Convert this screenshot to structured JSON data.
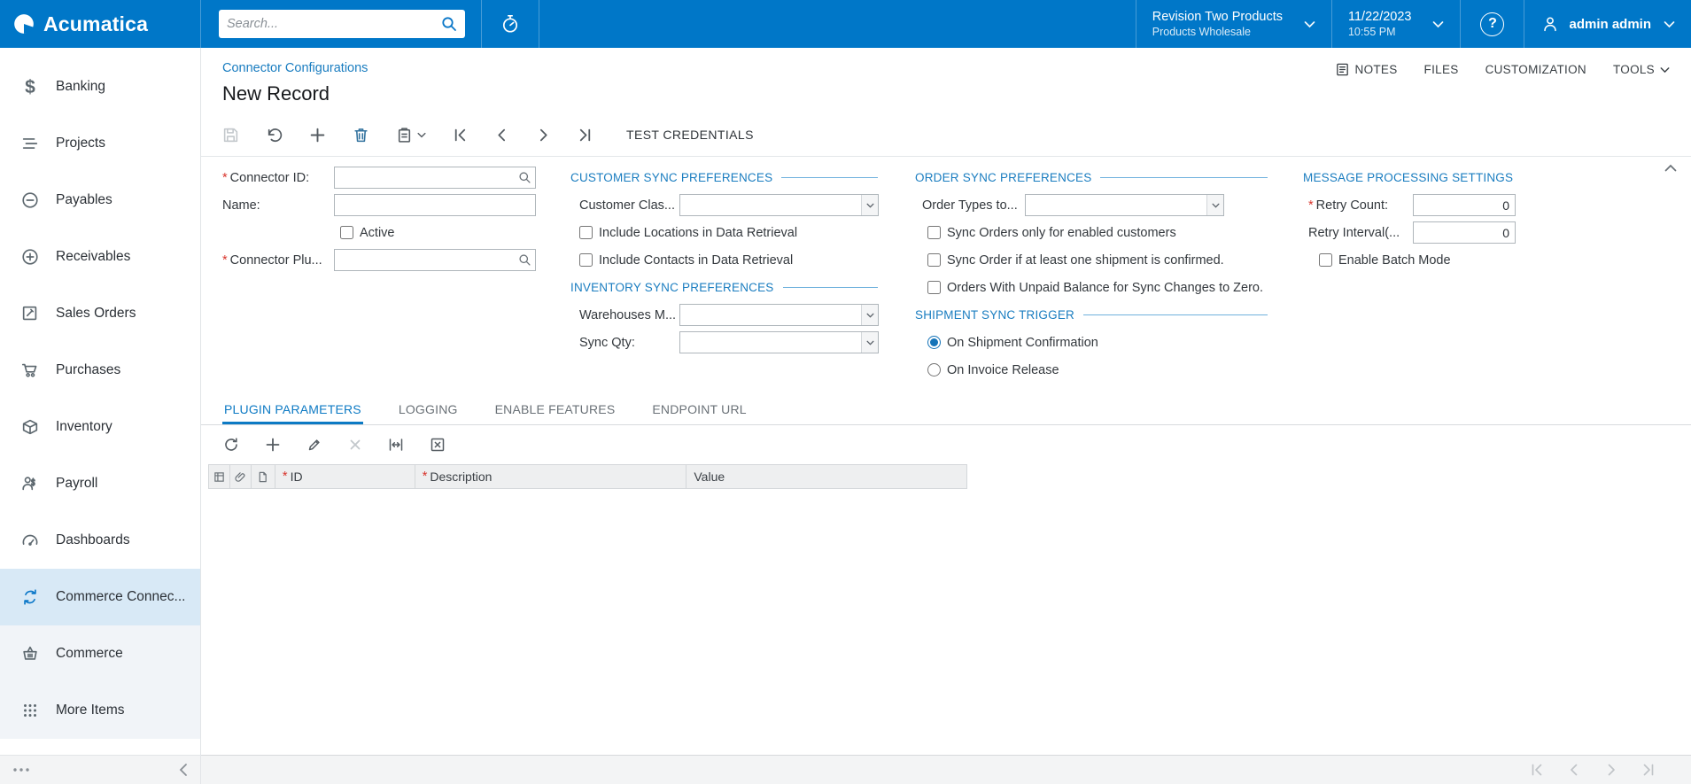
{
  "ui": {
    "required_marker": "*",
    "help_glyph": "?",
    "dollar_glyph": "$"
  },
  "colors": {
    "brand_blue": "#0077c8",
    "link_blue": "#1a7dc0",
    "required_red": "#d8342c",
    "selected_nav_bg": "#d8e9f6",
    "tab_active_blue": "#0d7ac4"
  },
  "topbar": {
    "brand": "Acumatica",
    "search_placeholder": "Search...",
    "company_name": "Revision Two Products",
    "company_branch": "Products Wholesale",
    "date": "11/22/2023",
    "time": "10:55 PM",
    "user": "admin admin"
  },
  "sidebar": {
    "items": [
      {
        "label": "Banking"
      },
      {
        "label": "Projects"
      },
      {
        "label": "Payables"
      },
      {
        "label": "Receivables"
      },
      {
        "label": "Sales Orders"
      },
      {
        "label": "Purchases"
      },
      {
        "label": "Inventory"
      },
      {
        "label": "Payroll"
      },
      {
        "label": "Dashboards"
      },
      {
        "label": "Commerce Connec..."
      },
      {
        "label": "Commerce"
      },
      {
        "label": "More Items"
      }
    ]
  },
  "header": {
    "breadcrumb": "Connector Configurations",
    "title": "New Record",
    "actions": {
      "notes": "NOTES",
      "files": "FILES",
      "customization": "CUSTOMIZATION",
      "tools": "TOOLS"
    },
    "test_credentials": "TEST CREDENTIALS"
  },
  "form": {
    "connector_id_label": "Connector ID:",
    "name_label": "Name:",
    "active_label": "Active",
    "connector_plugin_label": "Connector Plu...",
    "customer_sync": {
      "title": "CUSTOMER SYNC PREFERENCES",
      "customer_class_label": "Customer Clas...",
      "include_locations_label": "Include Locations in Data Retrieval",
      "include_contacts_label": "Include Contacts in Data Retrieval"
    },
    "inventory_sync": {
      "title": "INVENTORY SYNC PREFERENCES",
      "warehouses_label": "Warehouses M...",
      "sync_qty_label": "Sync Qty:"
    },
    "order_sync": {
      "title": "ORDER SYNC PREFERENCES",
      "order_types_label": "Order Types to...",
      "enabled_customers_label": "Sync Orders only for enabled customers",
      "shipment_confirmed_label": "Sync Order if at least one shipment is confirmed.",
      "unpaid_balance_label": "Orders With Unpaid Balance for Sync Changes to Zero."
    },
    "shipment_trigger": {
      "title": "SHIPMENT SYNC TRIGGER",
      "on_shipment_label": "On Shipment Confirmation",
      "on_invoice_label": "On Invoice Release",
      "selected": "On Shipment Confirmation"
    },
    "message_settings": {
      "title": "MESSAGE PROCESSING SETTINGS",
      "retry_count_label": "Retry Count:",
      "retry_count_value": "0",
      "retry_interval_label": "Retry Interval(...",
      "retry_interval_value": "0",
      "enable_batch_label": "Enable Batch Mode"
    }
  },
  "tabs": [
    {
      "label": "PLUGIN PARAMETERS"
    },
    {
      "label": "LOGGING"
    },
    {
      "label": "ENABLE FEATURES"
    },
    {
      "label": "ENDPOINT URL"
    }
  ],
  "grid": {
    "columns": [
      {
        "label": "ID",
        "required": true
      },
      {
        "label": "Description",
        "required": true
      },
      {
        "label": "Value",
        "required": false
      }
    ]
  }
}
